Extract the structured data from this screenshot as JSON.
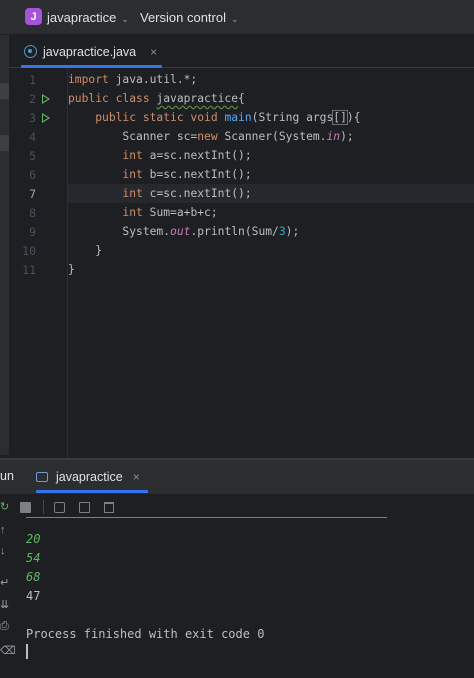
{
  "titlebar": {
    "project_initial": "J",
    "project_name": "javapractice",
    "vcs_label": "Version control",
    "chevron": "⌄"
  },
  "editor_tab": {
    "label": "javapractice.java",
    "close": "×"
  },
  "code_lines": [
    {
      "n": "1",
      "text": "import java.util.*;"
    },
    {
      "n": "2",
      "text": "public class javapractice{"
    },
    {
      "n": "3",
      "text": "    public static void main(String args[]){"
    },
    {
      "n": "4",
      "text": "        Scanner sc=new Scanner(System.in);"
    },
    {
      "n": "5",
      "text": "        int a=sc.nextInt();"
    },
    {
      "n": "6",
      "text": "        int b=sc.nextInt();"
    },
    {
      "n": "7",
      "text": "        int c=sc.nextInt();"
    },
    {
      "n": "8",
      "text": "        int Sum=a+b+c;"
    },
    {
      "n": "9",
      "text": "        System.out.println(Sum/3);"
    },
    {
      "n": "10",
      "text": "    }"
    },
    {
      "n": "11",
      "text": "}"
    }
  ],
  "run_panel": {
    "title": "un",
    "tab_label": "javapractice",
    "tab_close": "×"
  },
  "console": {
    "inputs": [
      "20",
      "54",
      "68"
    ],
    "output": "47",
    "exit_message": "Process finished with exit code 0"
  },
  "colors": {
    "accent": "#3574f0",
    "run_green": "#5fb865",
    "keyword": "#cf8e6d",
    "function": "#56a8f5"
  }
}
